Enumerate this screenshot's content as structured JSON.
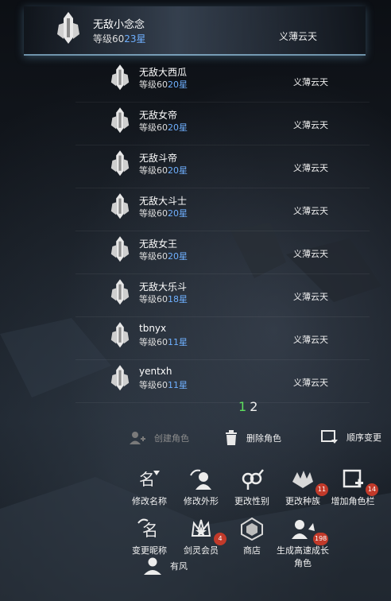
{
  "current": {
    "name": "无敌小念念",
    "level_prefix": "等级60",
    "level_hi": "23星",
    "server": "义薄云天"
  },
  "characters": [
    {
      "name": "无敌大西瓜",
      "level_prefix": "等级60",
      "level_hi": "20星",
      "server": "义薄云天"
    },
    {
      "name": "无敌女帝",
      "level_prefix": "等级60",
      "level_hi": "20星",
      "server": "义薄云天"
    },
    {
      "name": "无敌斗帝",
      "level_prefix": "等级60",
      "level_hi": "20星",
      "server": "义薄云天"
    },
    {
      "name": "无敌大斗士",
      "level_prefix": "等级60",
      "level_hi": "20星",
      "server": "义薄云天"
    },
    {
      "name": "无敌女王",
      "level_prefix": "等级60",
      "level_hi": "20星",
      "server": "义薄云天"
    },
    {
      "name": "无敌大乐斗",
      "level_prefix": "等级60",
      "level_hi": "18星",
      "server": "义薄云天"
    },
    {
      "name": "tbnyx",
      "level_prefix": "等级60",
      "level_hi": "11星",
      "server": "义薄云天"
    },
    {
      "name": "yentxh",
      "level_prefix": "等级60",
      "level_hi": "11星",
      "server": "义薄云天"
    }
  ],
  "pager": {
    "page1": "1",
    "page2": "2"
  },
  "actions": {
    "create": "创建角色",
    "delete": "删除角色",
    "reorder": "顺序变更"
  },
  "grid": {
    "rename": "修改名称",
    "appearance": "修改外形",
    "gender": "更改性别",
    "race": "更改种族",
    "race_badge": "11",
    "add_slot": "增加角色栏",
    "add_slot_badge": "14",
    "nickname": "变更昵称",
    "vip": "剑灵会员",
    "vip_badge": "4",
    "shop": "商店",
    "fast_gen_line1": "生成高速成长",
    "fast_gen_line2": "角色",
    "fast_gen_badge": "198",
    "friend": "有风"
  },
  "colors": {
    "level_highlight": "#6fb0ff",
    "page_active": "#5fe05f",
    "badge": "#c23a2a"
  }
}
